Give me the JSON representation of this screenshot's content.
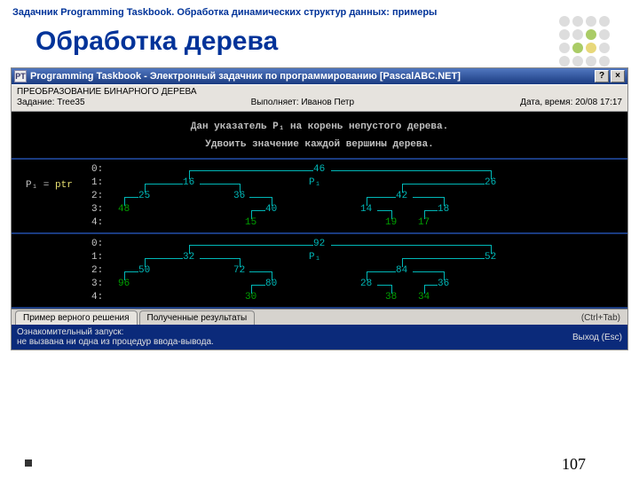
{
  "slide": {
    "header": "Задачник Programming Taskbook. Обработка динамических структур данных: примеры",
    "title": "Обработка дерева",
    "page": "107"
  },
  "window": {
    "title": "Programming Taskbook - Электронный задачник по программированию [PascalABC.NET]",
    "help_btn": "?",
    "close_btn": "×"
  },
  "meta": {
    "taskTitle": "ПРЕОБРАЗОВАНИЕ БИНАРНОГО ДЕРЕВА",
    "taskLabel": "Задание: Tree35",
    "executorLabel": "Выполняет: Иванов Петр",
    "dateLabel": "Дата, время: 20/08 17:17"
  },
  "instr": {
    "line1": "Дан указатель P₁ на корень непустого дерева.",
    "line2": "Удвоить значение каждой вершины дерева."
  },
  "p1": {
    "prefix": "P₁ = ",
    "ptr": "ptr"
  },
  "levels": [
    "0:",
    "1:",
    "2:",
    "3:",
    "4:"
  ],
  "tree1": {
    "root": "46",
    "n10": "16",
    "n11": "P₁",
    "n12": "26",
    "n20": "25",
    "n21": "36",
    "n22": "42",
    "n30": "48",
    "n31": "40",
    "n32": "14",
    "n33": "18",
    "n40": "15",
    "n41": "19",
    "n42": "17"
  },
  "tree2": {
    "root": "92",
    "n10": "32",
    "n11": "P₁",
    "n12": "52",
    "n20": "50",
    "n21": "72",
    "n22": "84",
    "n30": "96",
    "n31": "80",
    "n32": "28",
    "n33": "36",
    "n40": "30",
    "n41": "38",
    "n42": "34"
  },
  "tabs": {
    "t1": "Пример верного решения",
    "t2": "Полученные результаты",
    "hint": "(Ctrl+Tab)"
  },
  "status": {
    "line1": "Ознакомительный запуск:",
    "line2": "  не вызвана ни одна из процедур ввода-вывода.",
    "exit": "Выход (Esc)"
  }
}
